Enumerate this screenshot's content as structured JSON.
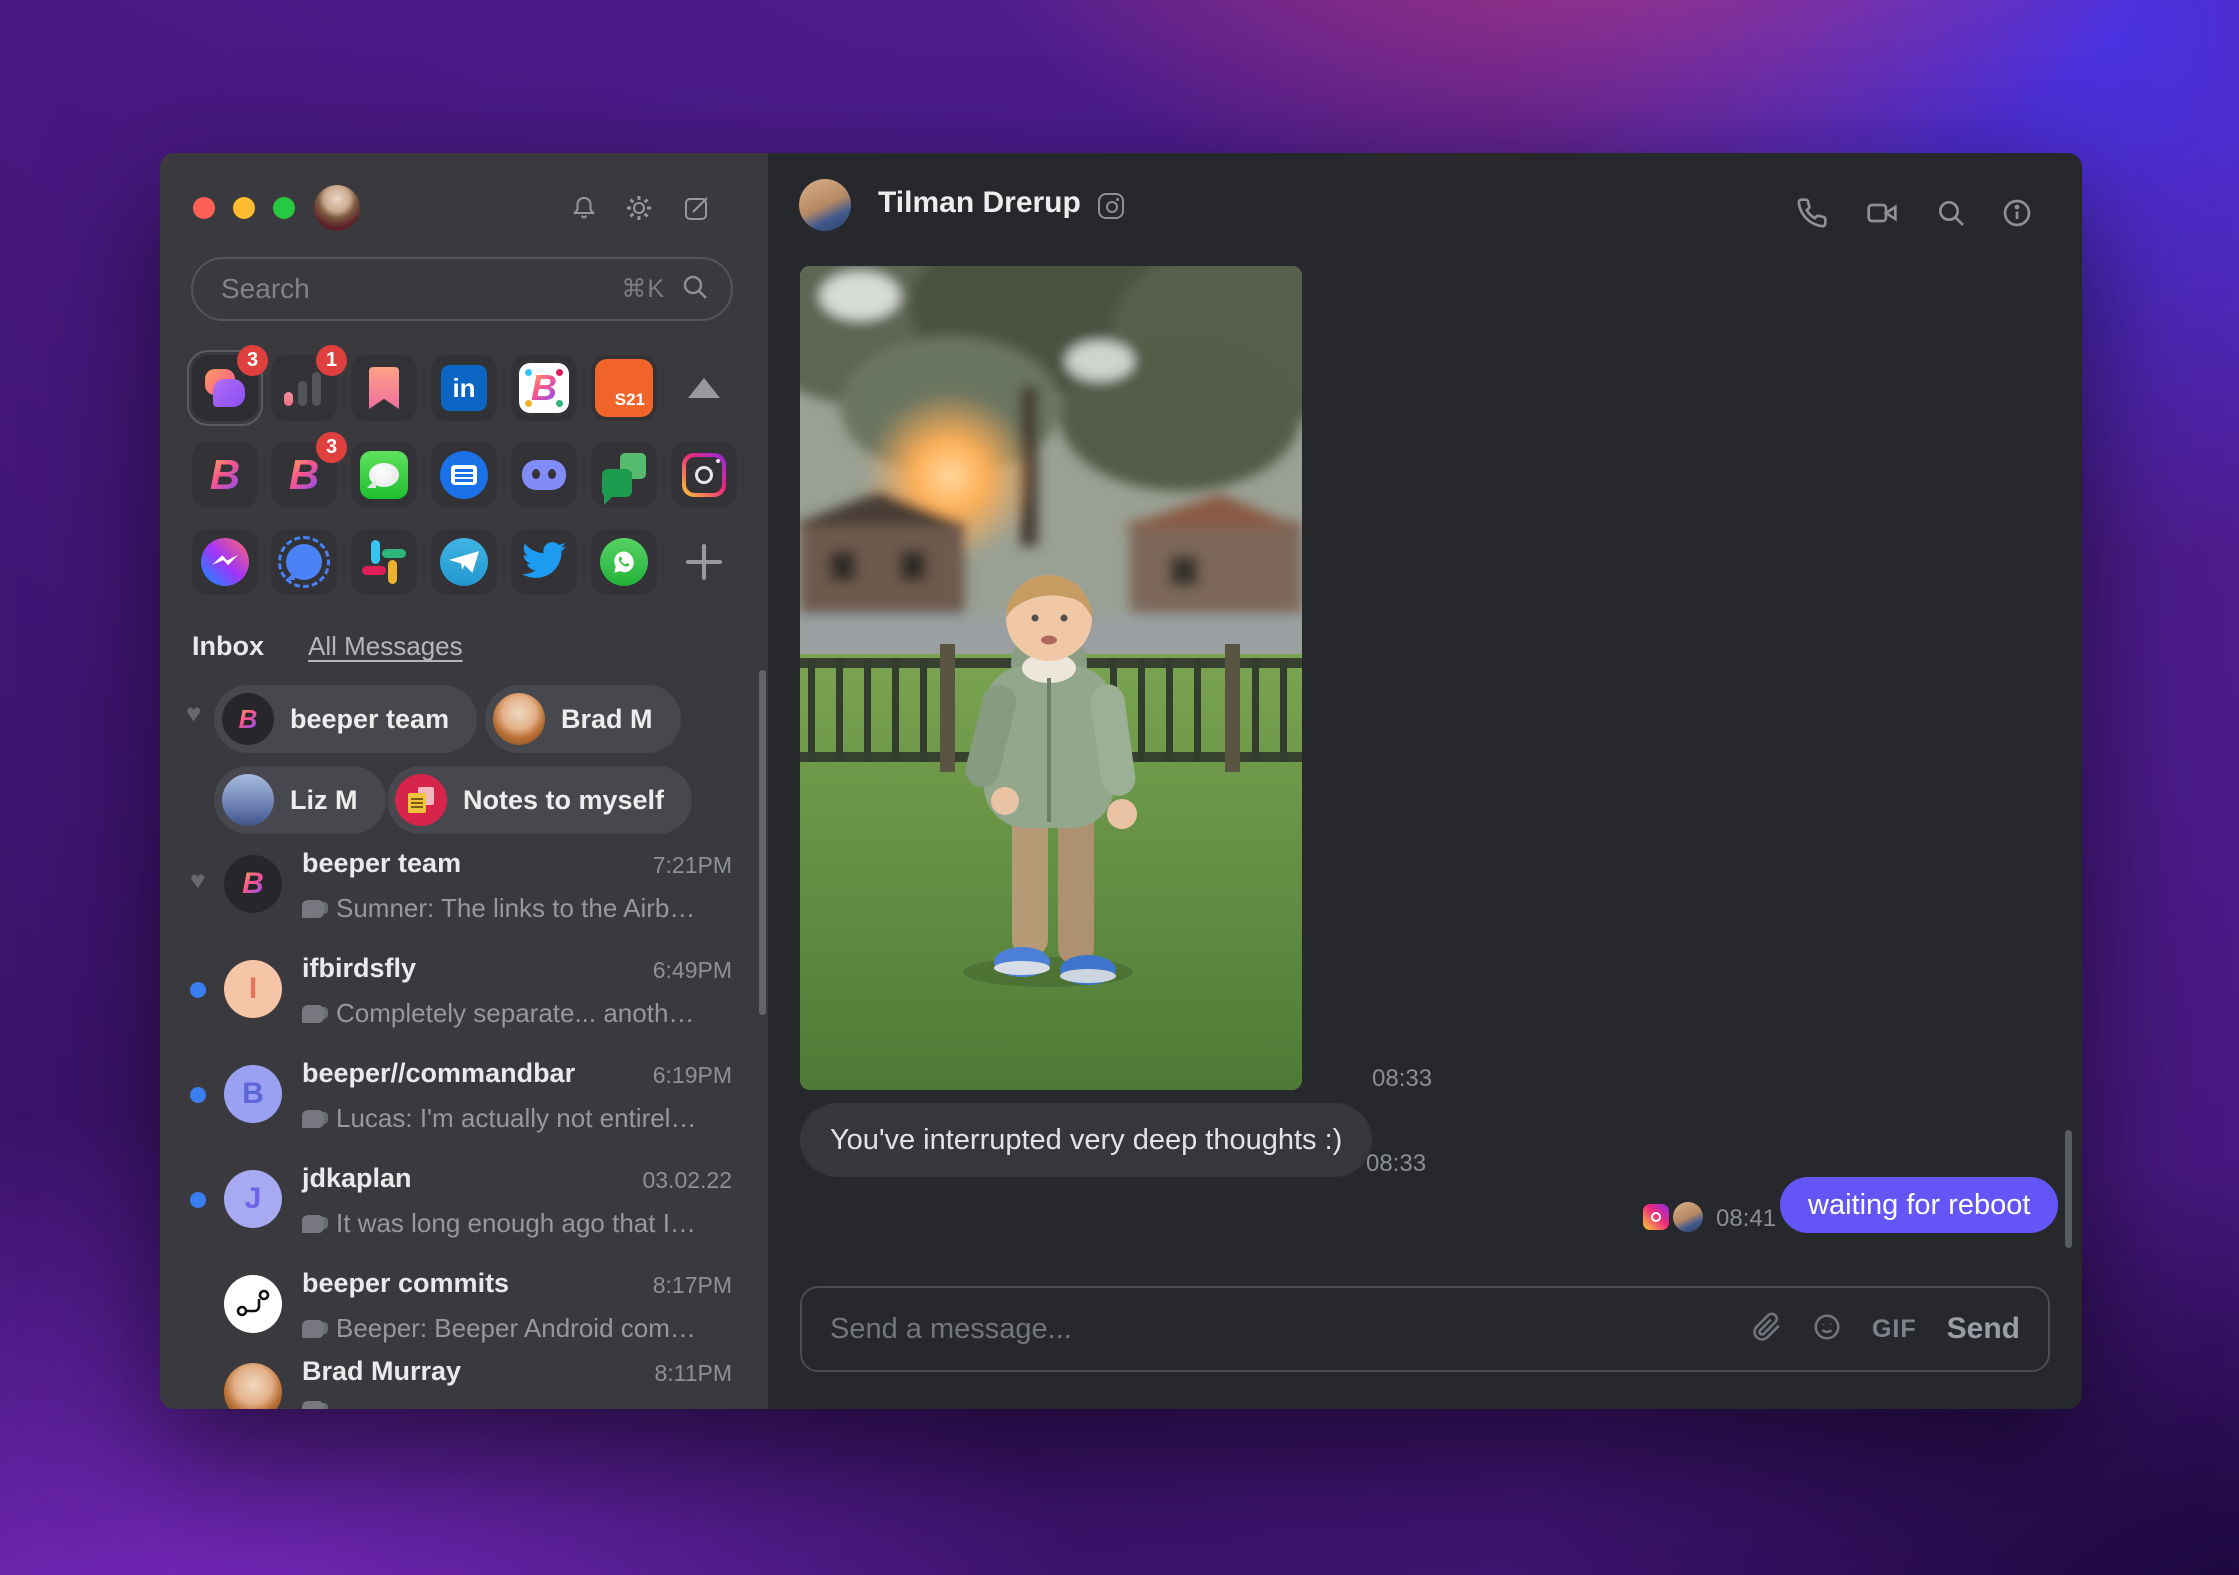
{
  "colors": {
    "accent": "#6456f6",
    "unread_dot": "#3b7ef2",
    "badge": "#df403e",
    "sidebar_bg": "#3a3a3e",
    "chat_bg": "#26282c"
  },
  "sidebar": {
    "search": {
      "placeholder": "Search",
      "shortcut": "⌘K"
    },
    "networks": [
      {
        "id": "beeper-inbox",
        "badge": "3"
      },
      {
        "id": "activity",
        "badge": "1"
      },
      {
        "id": "bookmarks"
      },
      {
        "id": "linkedin",
        "glyph": "in"
      },
      {
        "id": "beeper-tile",
        "glyph": "B"
      },
      {
        "id": "s21",
        "label": "S21"
      },
      {
        "id": "collapse"
      },
      {
        "id": "beeper",
        "glyph": "B"
      },
      {
        "id": "beeper-2",
        "glyph": "B",
        "badge": "3"
      },
      {
        "id": "imessage"
      },
      {
        "id": "android-messages"
      },
      {
        "id": "discord"
      },
      {
        "id": "google-chat"
      },
      {
        "id": "instagram"
      },
      {
        "id": "messenger"
      },
      {
        "id": "signal"
      },
      {
        "id": "slack"
      },
      {
        "id": "telegram"
      },
      {
        "id": "twitter"
      },
      {
        "id": "whatsapp"
      },
      {
        "id": "add-network"
      }
    ],
    "inbox": {
      "title": "Inbox",
      "filter": "All Messages"
    },
    "favorites": [
      {
        "label": "beeper team"
      },
      {
        "label": "Brad M"
      },
      {
        "label": "Liz M"
      },
      {
        "label": "Notes to myself"
      }
    ],
    "chats": [
      {
        "name": "beeper team",
        "time": "7:21PM",
        "preview": "Sumner: The links to the Airbnbs ...",
        "favorite": true
      },
      {
        "name": "ifbirdsfly",
        "time": "6:49PM",
        "preview": "Completely separate... another r...",
        "avatar_letter": "I",
        "unread": true
      },
      {
        "name": "beeper//commandbar",
        "time": "6:19PM",
        "preview": "Lucas: I'm actually not entirely su...",
        "avatar_letter": "B",
        "unread": true
      },
      {
        "name": "jdkaplan",
        "time": "03.02.22",
        "preview": "It was long enough ago that I cou...",
        "avatar_letter": "J",
        "unread": true
      },
      {
        "name": "beeper commits",
        "time": "8:17PM",
        "preview": "Beeper: Beeper Android commit ..."
      },
      {
        "name": "Brad Murray",
        "time": "8:11PM",
        "preview": ""
      }
    ]
  },
  "chat": {
    "title": "Tilman Drerup",
    "messages": {
      "photo_time": "08:33",
      "incoming": {
        "text": "You've interrupted very deep thoughts :)",
        "time": "08:33"
      },
      "outgoing": {
        "text": "waiting for reboot",
        "time": "08:41"
      }
    },
    "composer": {
      "placeholder": "Send a message...",
      "gif_label": "GIF",
      "send_label": "Send"
    }
  }
}
